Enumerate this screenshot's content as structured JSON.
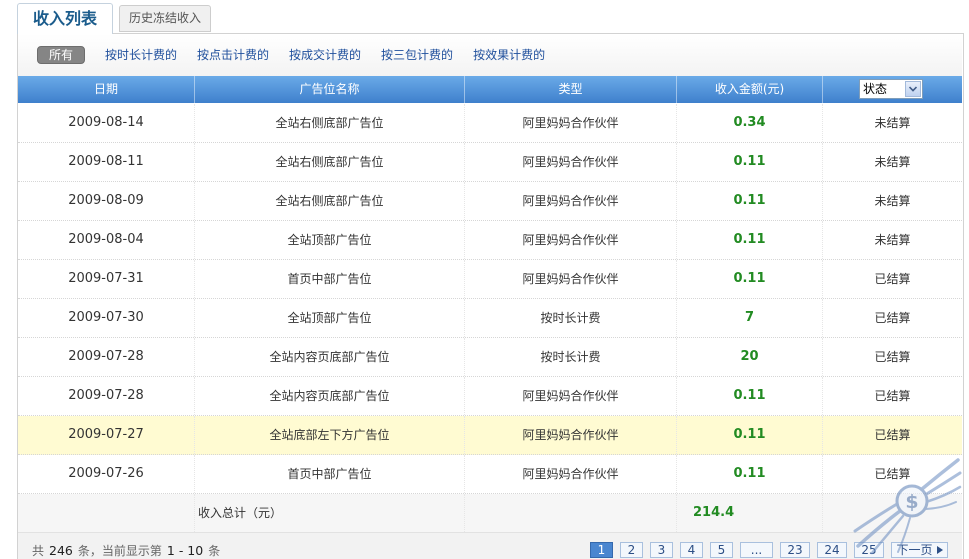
{
  "tabs": {
    "income_list": "收入列表",
    "frozen_history": "历史冻结收入"
  },
  "filters": {
    "all": "所有",
    "links": [
      "按时长计费的",
      "按点击计费的",
      "按成交计费的",
      "按三包计费的",
      "按效果计费的"
    ]
  },
  "table": {
    "headers": {
      "date": "日期",
      "slot": "广告位名称",
      "type": "类型",
      "amount": "收入金额(元)"
    },
    "status_select": "状态",
    "rows": [
      {
        "date": "2009-08-14",
        "slot": "全站右侧底部广告位",
        "type": "阿里妈妈合作伙伴",
        "amount": "0.34",
        "status": "未结算"
      },
      {
        "date": "2009-08-11",
        "slot": "全站右侧底部广告位",
        "type": "阿里妈妈合作伙伴",
        "amount": "0.11",
        "status": "未结算"
      },
      {
        "date": "2009-08-09",
        "slot": "全站右侧底部广告位",
        "type": "阿里妈妈合作伙伴",
        "amount": "0.11",
        "status": "未结算"
      },
      {
        "date": "2009-08-04",
        "slot": "全站顶部广告位",
        "type": "阿里妈妈合作伙伴",
        "amount": "0.11",
        "status": "未结算"
      },
      {
        "date": "2009-07-31",
        "slot": "首页中部广告位",
        "type": "阿里妈妈合作伙伴",
        "amount": "0.11",
        "status": "已结算"
      },
      {
        "date": "2009-07-30",
        "slot": "全站顶部广告位",
        "type": "按时长计费",
        "amount": "7",
        "status": "已结算"
      },
      {
        "date": "2009-07-28",
        "slot": "全站内容页底部广告位",
        "type": "按时长计费",
        "amount": "20",
        "status": "已结算"
      },
      {
        "date": "2009-07-28",
        "slot": "全站内容页底部广告位",
        "type": "阿里妈妈合作伙伴",
        "amount": "0.11",
        "status": "已结算"
      },
      {
        "date": "2009-07-27",
        "slot": "全站底部左下方广告位",
        "type": "阿里妈妈合作伙伴",
        "amount": "0.11",
        "status": "已结算",
        "highlighted": true
      },
      {
        "date": "2009-07-26",
        "slot": "首页中部广告位",
        "type": "阿里妈妈合作伙伴",
        "amount": "0.11",
        "status": "已结算"
      }
    ],
    "total": {
      "label": "收入总计（元）",
      "value": "214.4"
    }
  },
  "pagination": {
    "summary": {
      "prefix": "共",
      "count": "246",
      "middle": "条，当前显示第",
      "range": "1 - 10",
      "suffix": "条"
    },
    "pages": [
      "1",
      "2",
      "3",
      "4",
      "5",
      "...",
      "23",
      "24",
      "25"
    ],
    "next": "下一页"
  },
  "watermark": {
    "symbol": "$"
  },
  "icons": {
    "select_arrow": "chevron-down-icon",
    "next_arrow": "triangle-right-icon"
  },
  "colors": {
    "accent": "#4a86d0",
    "amount": "#228b22",
    "highlight_row": "#fffbd2",
    "link": "#1f4f9c",
    "header_top": "#6aaae8",
    "header_bottom": "#3f80cc"
  }
}
